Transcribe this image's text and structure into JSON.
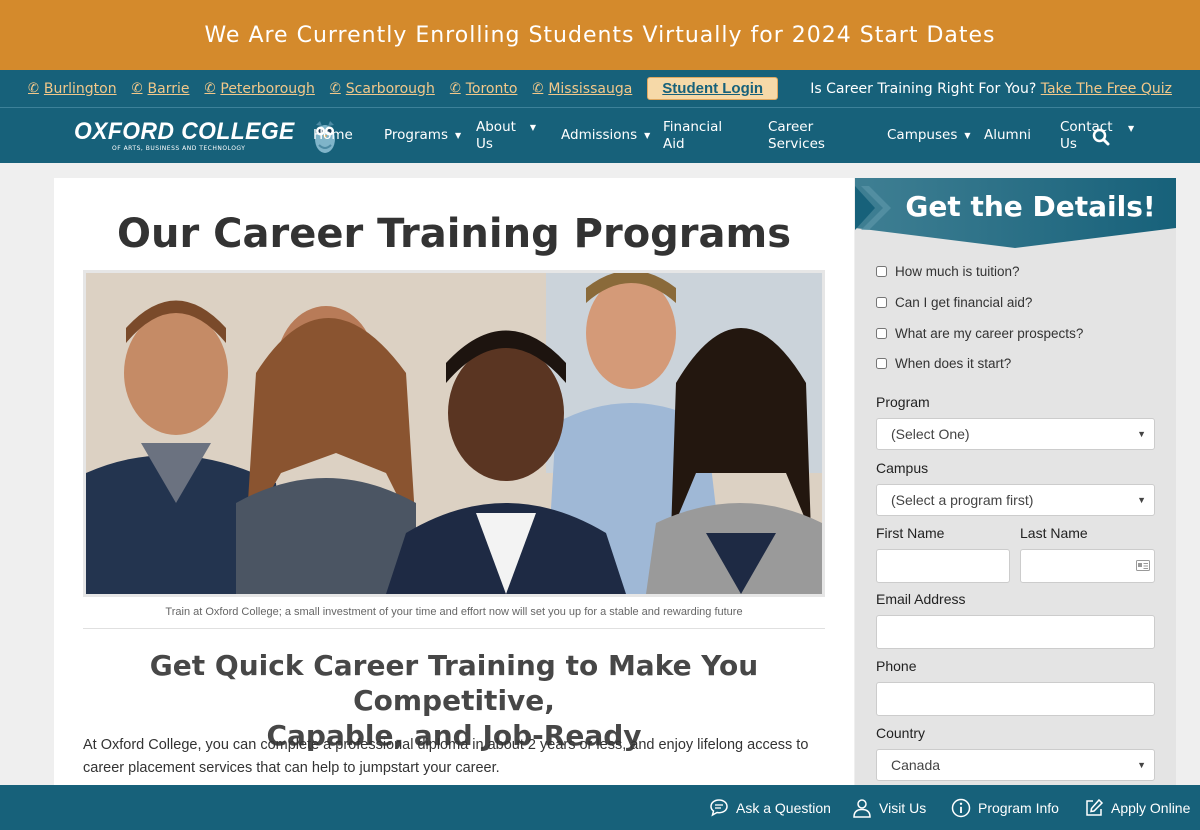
{
  "announcement": "We Are Currently Enrolling Students Virtually for 2024 Start Dates",
  "campuses": [
    "Burlington",
    "Barrie",
    "Peterborough",
    "Scarborough",
    "Toronto",
    "Mississauga"
  ],
  "student_login": "Student Login",
  "quiz": {
    "prompt": "Is Career Training Right For You?",
    "link": "Take The Free Quiz"
  },
  "logo": {
    "main": "OXFORD COLLEGE",
    "sub": "OF ARTS, BUSINESS AND TECHNOLOGY"
  },
  "nav": {
    "home": "Home",
    "programs": "Programs",
    "about_1": "About",
    "about_2": "Us",
    "admissions": "Admissions",
    "financial_1": "Financial",
    "financial_2": "Aid",
    "career_1": "Career",
    "career_2": "Services",
    "campuses": "Campuses",
    "alumni": "Alumni",
    "contact_1": "Contact",
    "contact_2": "Us"
  },
  "main": {
    "title": "Our Career Training Programs",
    "caption": "Train at Oxford College; a small investment of your time and effort now will set you up for a stable and rewarding future",
    "subtitle_1": "Get Quick Career Training to Make You Competitive,",
    "subtitle_2": "Capable, and Job-Ready",
    "body_1": "At Oxford College, you can complete a professional diploma in about 2 years or less, and enjoy lifelong access to",
    "body_2": "career placement services that can help to jumpstart your career."
  },
  "form": {
    "title": "Get the Details!",
    "checks": [
      "How much is tuition?",
      "Can I get financial aid?",
      "What are my career prospects?",
      "When does it start?"
    ],
    "program_label": "Program",
    "program_value": "(Select One)",
    "campus_label": "Campus",
    "campus_value": "(Select a program first)",
    "first_name_label": "First Name",
    "last_name_label": "Last Name",
    "email_label": "Email Address",
    "phone_label": "Phone",
    "country_label": "Country",
    "country_value": "Canada"
  },
  "bottom_bar": {
    "ask": "Ask a Question",
    "visit": "Visit Us",
    "info": "Program Info",
    "apply": "Apply Online"
  },
  "colors": {
    "banner": "#d48a2c",
    "teal": "#17617a",
    "link_gold": "#f2c88a"
  }
}
